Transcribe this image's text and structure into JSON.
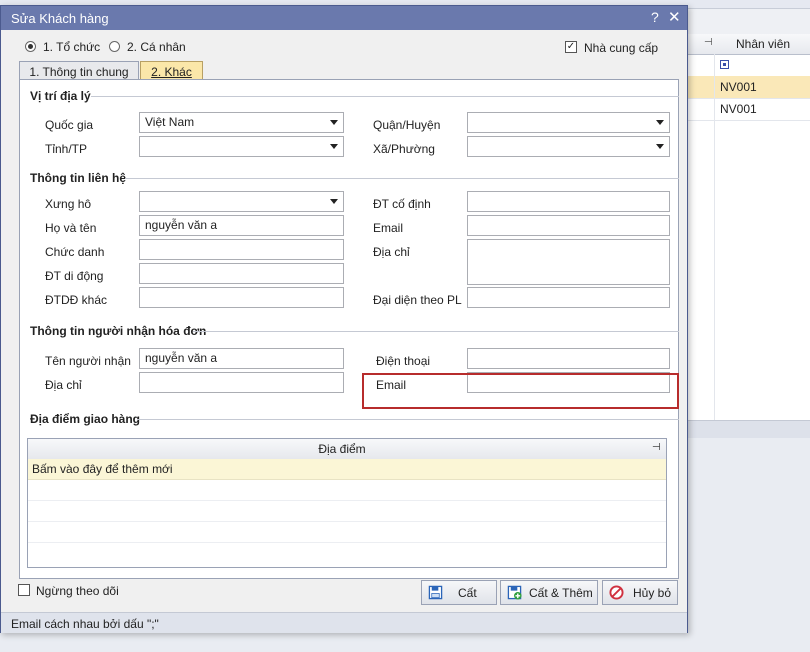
{
  "background_grid": {
    "column_header": "Nhân viên",
    "rows": [
      "NV001",
      "NV001"
    ]
  },
  "dialog": {
    "title": "Sửa Khách hàng",
    "help_glyph": "?",
    "close_glyph": "✕",
    "radio_org": "1. Tổ chức",
    "radio_person": "2. Cá nhân",
    "supplier_label": "Nhà cung cấp",
    "supplier_checked": true,
    "tabs": [
      "1. Thông tin chung",
      "2. Khác"
    ],
    "sections": {
      "geo": "Vị trí địa lý",
      "contact": "Thông tin liên hệ",
      "invoice": "Thông tin người nhận hóa đơn",
      "delivery": "Địa điểm giao hàng"
    },
    "geo": {
      "country_label": "Quốc gia",
      "country_value": "Việt Nam",
      "province_label": "Tỉnh/TP",
      "province_value": "",
      "district_label": "Quận/Huyện",
      "district_value": "",
      "ward_label": "Xã/Phường",
      "ward_value": ""
    },
    "contact": {
      "salutation_label": "Xưng hô",
      "salutation_value": "",
      "fullname_label": "Họ và tên",
      "fullname_value": "nguyễn văn a",
      "title_label": "Chức danh",
      "title_value": "",
      "mobile_label": "ĐT di động",
      "mobile_value": "",
      "other_mobile_label": "ĐTDĐ khác",
      "other_mobile_value": "",
      "landline_label": "ĐT cố định",
      "landline_value": "",
      "email_label": "Email",
      "email_value": "",
      "address_label": "Địa chỉ",
      "address_value": "",
      "legal_rep_label": "Đại diện theo PL",
      "legal_rep_value": ""
    },
    "invoice": {
      "receiver_label": "Tên người nhận",
      "receiver_value": "nguyễn văn a",
      "address_label": "Địa chỉ",
      "address_value": "",
      "phone_label": "Điện thoại",
      "phone_value": "",
      "email_label": "Email",
      "email_value": ""
    },
    "delivery": {
      "column_header": "Địa điểm",
      "new_row_hint": "Bấm vào đây để thêm mới"
    },
    "inactive_label": "Ngừng theo dõi",
    "inactive_checked": false,
    "buttons": {
      "save": "Cất",
      "save_add": "Cất & Thêm",
      "cancel": "Hủy bỏ"
    },
    "status_text": "Email cách nhau bởi dấu \";\""
  },
  "colors": {
    "titlebar": "#6a79ad",
    "active_tab": "#fbe7a9",
    "highlight_box": "#b72c2c",
    "selected_row": "#fae8b8"
  }
}
